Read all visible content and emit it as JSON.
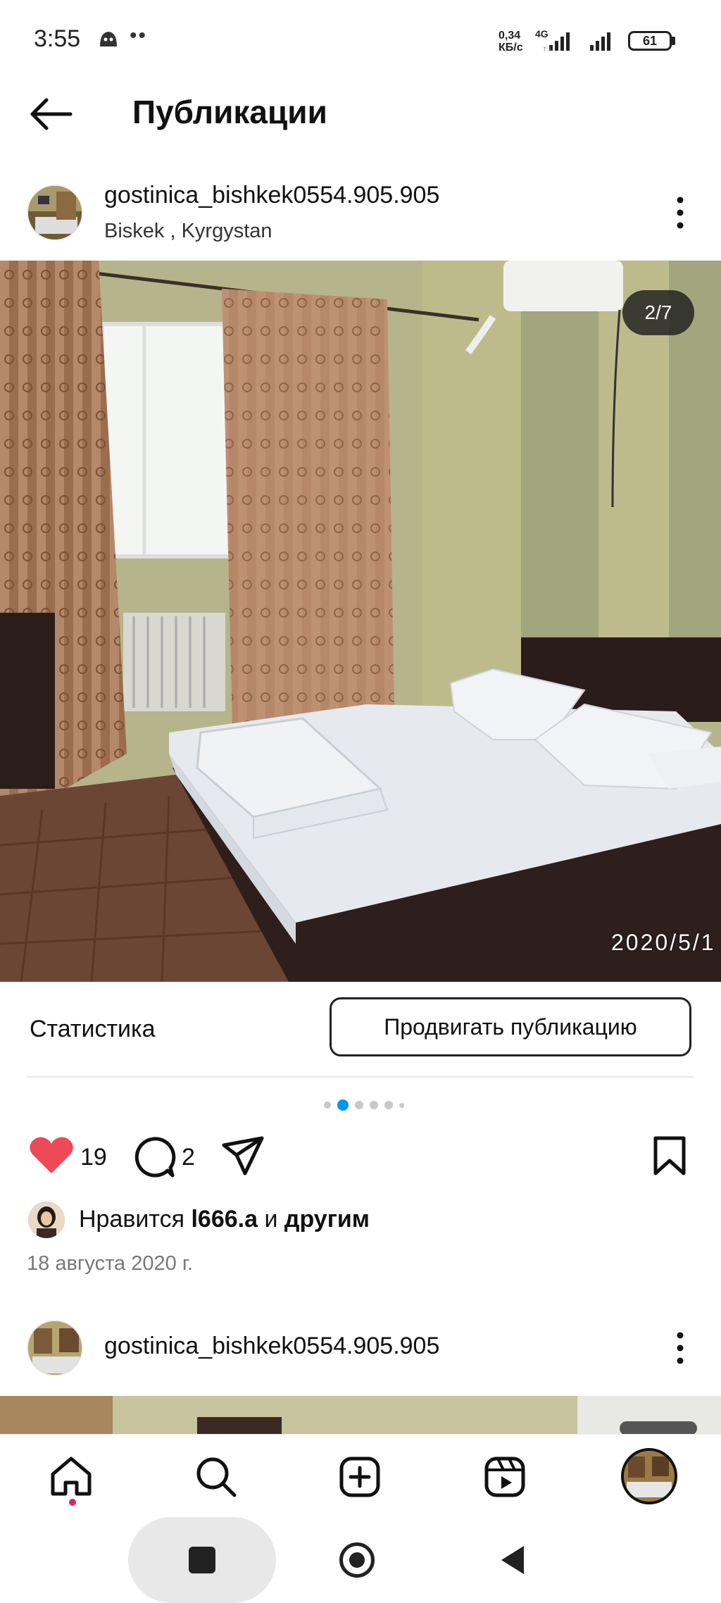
{
  "status_bar": {
    "time": "3:55",
    "dots": "••",
    "speed_value": "0,34",
    "speed_unit": "КБ/с",
    "network": "4G",
    "battery": "61"
  },
  "header": {
    "title": "Публикации"
  },
  "post": {
    "username": "gostinica_bishkek0554.905.905",
    "location": "Biskek , Kyrgystan",
    "image_counter": "2/7",
    "photo_date": "2020/5/1",
    "stats_label": "Статистика",
    "promote_label": "Продвигать публикацию",
    "carousel": {
      "total_dots": 6,
      "active_index": 1
    },
    "like_count": "19",
    "comment_count": "2",
    "liked_prefix": "Нравится ",
    "liked_user": "l666.a",
    "liked_middle": " и ",
    "liked_others": "другим",
    "date": "18 августа 2020 г.",
    "liked": true
  },
  "second_post": {
    "username": "gostinica_bishkek0554.905.905"
  },
  "colors": {
    "like_red": "#ed4956",
    "active_dot": "#0095f6",
    "notification_dot": "#e0245e"
  },
  "icons": [
    "back-arrow-icon",
    "more-vertical-icon",
    "heart-icon",
    "comment-icon",
    "share-icon",
    "bookmark-icon",
    "home-icon",
    "search-icon",
    "add-post-icon",
    "reels-icon"
  ]
}
